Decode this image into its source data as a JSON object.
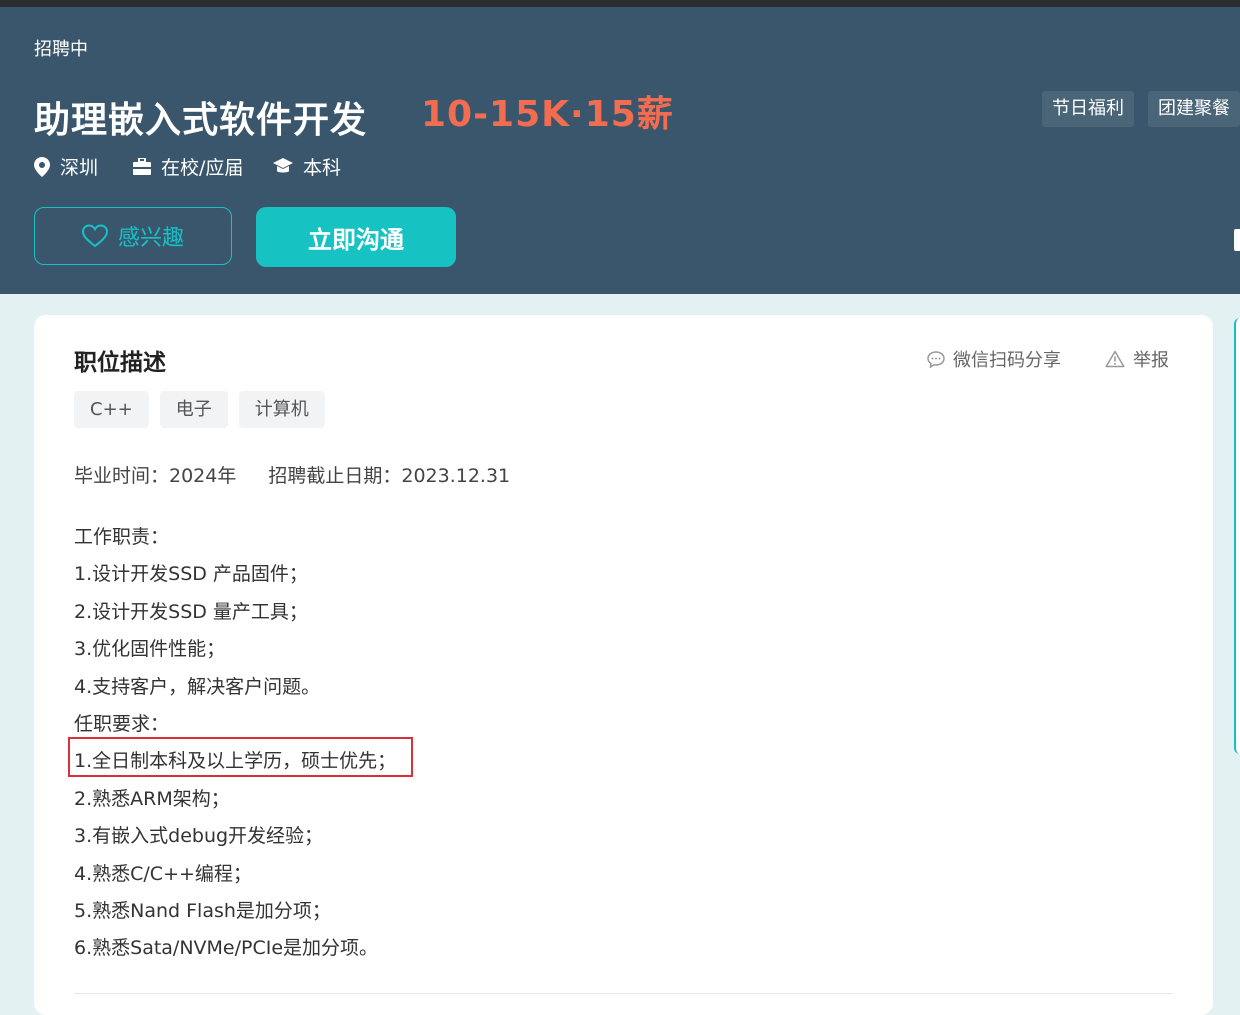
{
  "job": {
    "status": "招聘中",
    "title": "助理嵌入式软件开发",
    "salary": "10-15K·15薪",
    "benefits": [
      "节日福利",
      "团建聚餐"
    ],
    "location": "深圳",
    "experience": "在校/应届",
    "education": "本科"
  },
  "actions": {
    "interest_label": "感兴趣",
    "chat_label": "立即沟通"
  },
  "description": {
    "title": "职位描述",
    "share_label": "微信扫码分享",
    "report_label": "举报",
    "tags": [
      "C++",
      "电子",
      "计算机"
    ],
    "graduation": "毕业时间：2024年",
    "deadline": "招聘截止日期：2023.12.31",
    "lines": [
      "工作职责：",
      "1.设计开发SSD 产品固件；",
      "2.设计开发SSD 量产工具；",
      "3.优化固件性能；",
      "4.支持客户，解决客户问题。",
      "任职要求：",
      "1.全日制本科及以上学历，硕士优先；",
      "2.熟悉ARM架构；",
      "3.有嵌入式debug开发经验；",
      "4.熟悉C/C++编程；",
      "5.熟悉Nand Flash是加分项；",
      "6.熟悉Sata/NVMe/PCIe是加分项。"
    ]
  },
  "colors": {
    "banner": "#3a566d",
    "accent": "#16c3c2",
    "salary": "#f26d4f",
    "highlight": "#d9303b"
  }
}
